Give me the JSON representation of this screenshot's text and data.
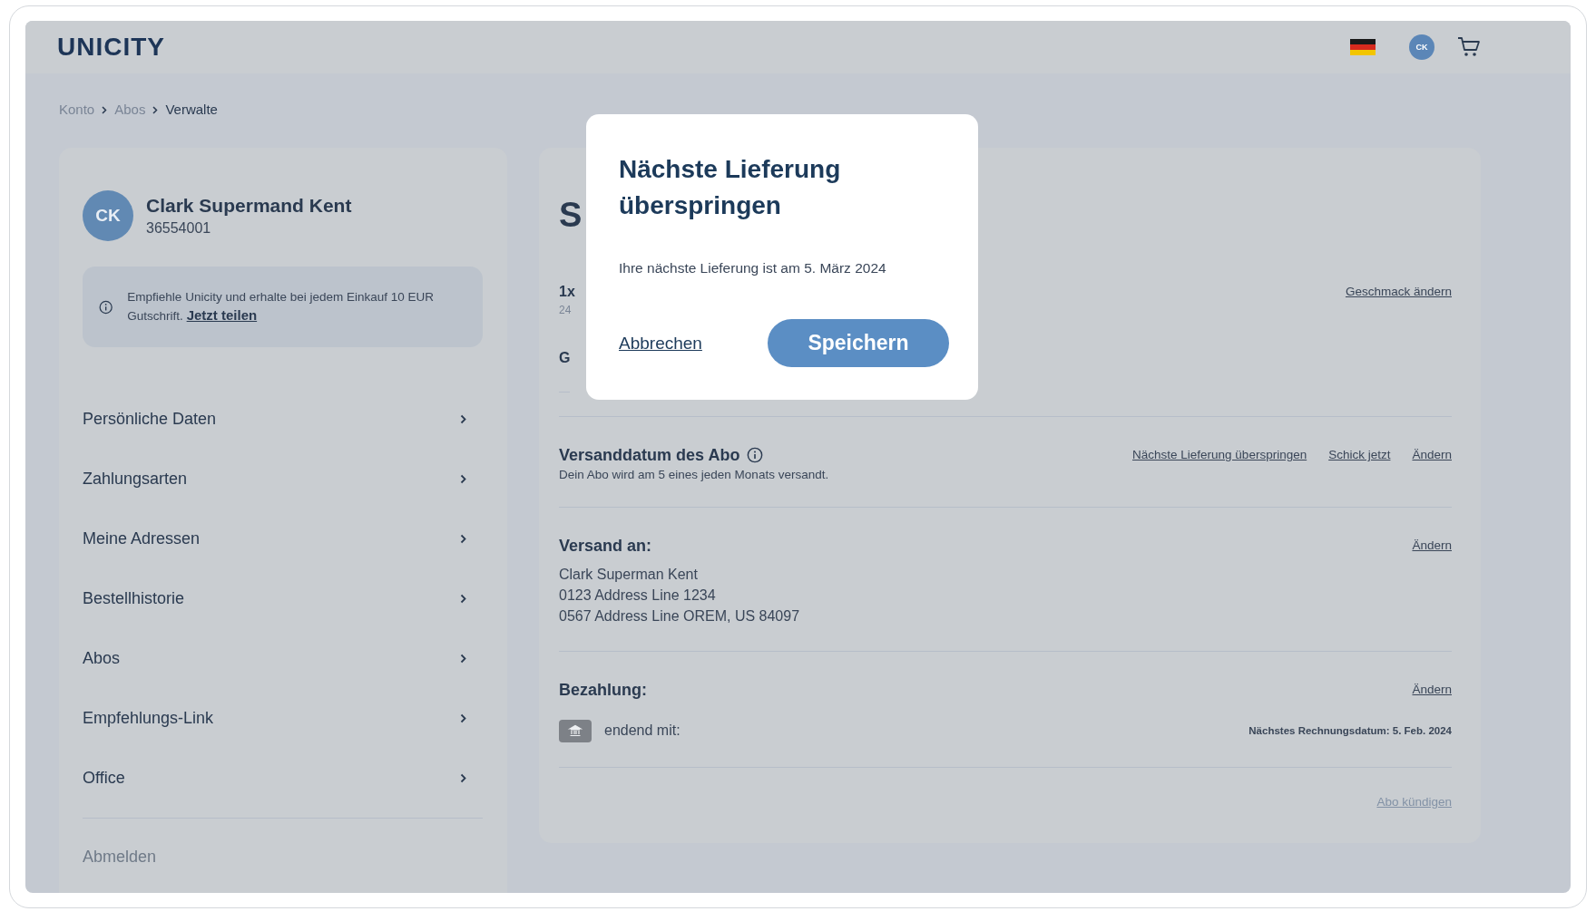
{
  "header": {
    "logo": "UNICITY",
    "avatar": "CK"
  },
  "breadcrumb": [
    {
      "label": "Konto",
      "current": false
    },
    {
      "label": "Abos",
      "current": false
    },
    {
      "label": "Verwalte",
      "current": true
    }
  ],
  "profile": {
    "initials": "CK",
    "name": "Clark Supermand Kent",
    "id": "36554001"
  },
  "referral": {
    "text": "Empfiehle Unicity und erhalte bei jedem Einkauf 10 EUR Gutschrift.",
    "link": "Jetzt teilen"
  },
  "menu": [
    {
      "label": "Persönliche Daten"
    },
    {
      "label": "Zahlungsarten"
    },
    {
      "label": "Meine Adressen"
    },
    {
      "label": "Bestellhistorie"
    },
    {
      "label": "Abos"
    },
    {
      "label": "Empfehlungs-Link"
    },
    {
      "label": "Office"
    }
  ],
  "logout": "Abmelden",
  "subscription": {
    "title": "S",
    "product_qty": "1x",
    "product_detail": "24",
    "flavor_link": "Geschmack ändern",
    "line": "G",
    "ship_date": {
      "title": "Versanddatum des Abo",
      "subtitle": "Dein Abo wird am 5 eines jeden Monats versandt.",
      "links": [
        "Nächste Lieferung überspringen",
        "Schick jetzt",
        "Ändern"
      ]
    },
    "shipping": {
      "title": "Versand an:",
      "link": "Ändern",
      "lines": [
        "Clark Superman Kent",
        "0123 Address Line 1234",
        "0567 Address Line OREM, US 84097"
      ]
    },
    "payment": {
      "title": "Bezahlung:",
      "link": "Ändern",
      "method": "endend mit:",
      "next_billing": "Nächstes Rechnungsdatum: 5. Feb. 2024"
    },
    "cancel_link": "Abo kündigen"
  },
  "modal": {
    "title": "Nächste Lieferung überspringen",
    "text": "Ihre nächste Lieferung ist am 5. März 2024",
    "cancel": "Abbrechen",
    "confirm": "Speichern"
  }
}
